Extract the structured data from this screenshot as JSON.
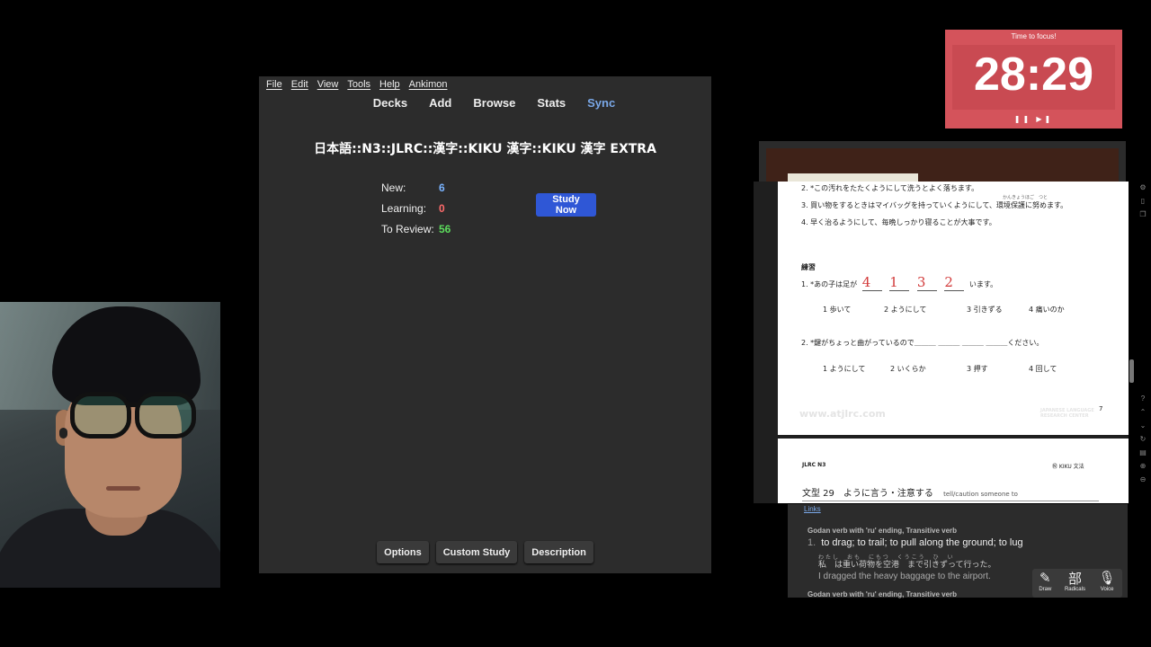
{
  "anki": {
    "menu": [
      "File",
      "Edit",
      "View",
      "Tools",
      "Help",
      "Ankimon"
    ],
    "toolbar": [
      "Decks",
      "Add",
      "Browse",
      "Stats",
      "Sync"
    ],
    "deck_title": "日本語::N3::JLRC::漢字::KIKU 漢字::KIKU 漢字 EXTRA",
    "new_label": "New:",
    "new_count": "6",
    "learning_label": "Learning:",
    "learning_count": "0",
    "review_label": "To Review:",
    "review_count": "56",
    "study_now": "Study Now",
    "bottom_buttons": [
      "Options",
      "Custom Study",
      "Description"
    ],
    "colors": {
      "new": "#79b3ff",
      "learning": "#ff6b6b",
      "review": "#5cdc5c",
      "accent": "#2f57d6"
    }
  },
  "timer": {
    "caption": "Time to focus!",
    "time": "28:29",
    "controls": "❚❚ ▶❚",
    "color": "#d4535b"
  },
  "pdf": {
    "line2": "2. *この汚れをたたくようにして洗うとよく落ちます。",
    "line3": "3. 買い物をするときはマイバッグを持っていくようにして、環境保護に努めます。",
    "line4": "4. 早く治るようにして、毎晩しっかり寝ることが大事です。",
    "furigana3": "かんきょうほご　つと",
    "practice_heading": "練習",
    "q1_prefix": "1. *あの子は足が",
    "q1_suffix": "います。",
    "q1_answers": [
      "4",
      "1",
      "3",
      "2"
    ],
    "q1_options": [
      "1 歩いて",
      "2 ようにして",
      "3 引きずる",
      "4 痛いのか"
    ],
    "q2_text": "2. *鍵がちょっと曲がっているので＿＿＿ ＿＿＿ ＿＿＿ ＿＿＿ください。",
    "q2_options": [
      "1 ようにして",
      "2 いくらか",
      "3 押す",
      "4 回して"
    ],
    "footer_url": "www.atjlrc.com",
    "footer_org": "JAPANESE LANGUAGE RESEARCH CENTER",
    "page_num": "7",
    "page2_left": "JLRC N3",
    "page2_right": "㊗ KIKU 文法",
    "page2_title": "文型 29　ように言う・注意する",
    "page2_title_en": "tell/caution someone to"
  },
  "dict": {
    "links": "Links",
    "pos1": "Godan verb with 'ru' ending, Transitive verb",
    "def_num": "1.",
    "def": "to drag; to trail; to pull along the ground; to lug",
    "furigana": "わたし　おも　にもつ　くうこう　ひ　い",
    "example_jp": "私　は重い荷物を空港　まで引きずって行った。",
    "example_en": "I dragged the heavy baggage to the airport.",
    "pos2": "Godan verb with 'ru' ending, Transitive verb",
    "tools": [
      {
        "icon": "✎",
        "label": "Draw"
      },
      {
        "icon": "部",
        "label": "Radicals"
      },
      {
        "icon": "🎙",
        "label": "Voice"
      }
    ]
  }
}
